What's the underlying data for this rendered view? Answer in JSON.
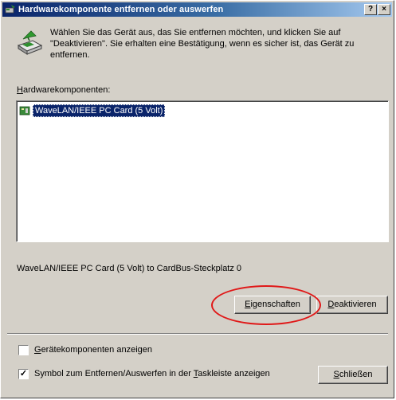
{
  "window": {
    "title": "Hardwarekomponente entfernen oder auswerfen",
    "help_button": "?",
    "close_button": "×"
  },
  "intro_text": "Wählen Sie das Gerät aus, das Sie entfernen möchten, und klicken Sie auf \"Deaktivieren\". Sie erhalten eine Bestätigung, wenn es sicher ist, das Gerät zu entfernen.",
  "list": {
    "label_accel": "H",
    "label_rest": "ardwarekomponenten:",
    "items": [
      {
        "label": "WaveLAN/IEEE PC Card (5 Volt)",
        "selected": true,
        "icon": "pc-card-icon"
      }
    ]
  },
  "status_text": "WaveLAN/IEEE PC Card (5 Volt) to CardBus-Steckplatz 0",
  "buttons": {
    "properties_accel": "E",
    "properties_rest": "igenschaften",
    "deactivate_accel": "D",
    "deactivate_rest": "eaktivieren",
    "close_accel": "S",
    "close_rest": "chließen"
  },
  "checkboxes": {
    "show_components": {
      "checked": false,
      "label_before": "",
      "label_accel": "G",
      "label_after": "erätekomponenten anzeigen"
    },
    "show_tray_icon": {
      "checked": true,
      "label_before": "Symbol zum Entfernen/Auswerfen in der ",
      "label_accel": "T",
      "label_after": "askleiste anzeigen"
    }
  },
  "colors": {
    "selection": "#0a246a",
    "annotation": "#e01818",
    "dialog_face": "#d4d0c8"
  }
}
